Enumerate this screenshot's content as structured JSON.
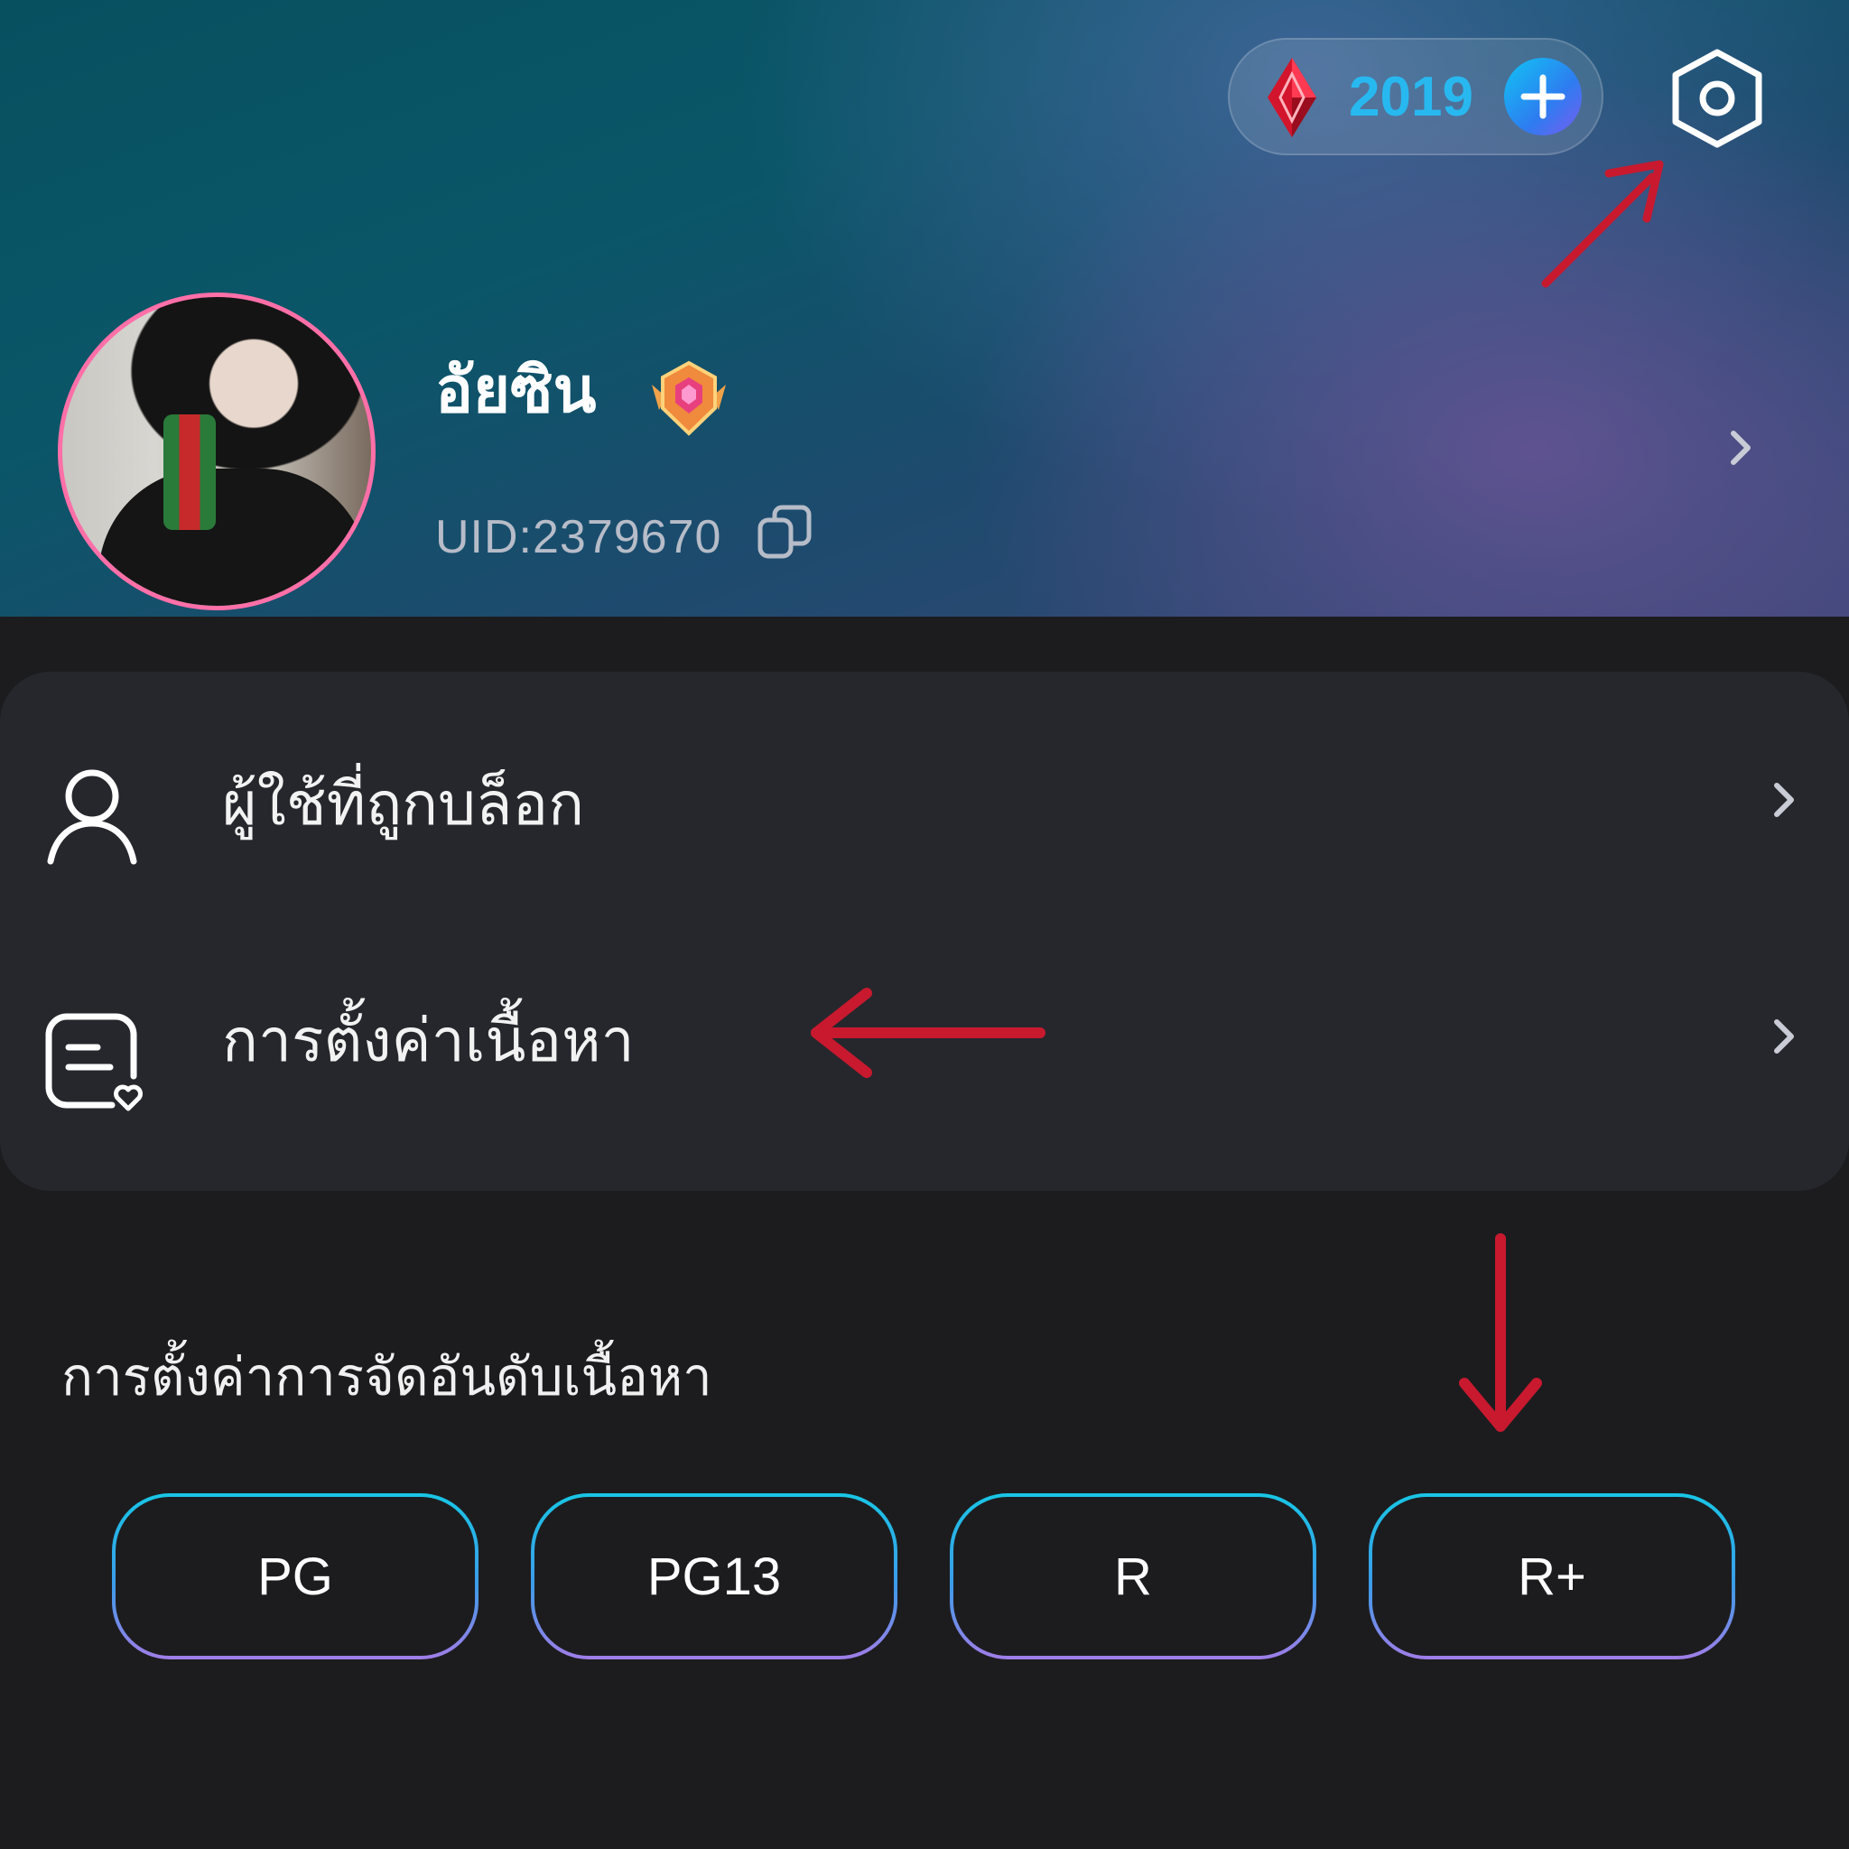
{
  "header": {
    "gems": {
      "count": "2019",
      "icon": "red-gem-icon",
      "add_icon": "plus-icon"
    },
    "settings_icon": "settings-hexagon-icon"
  },
  "profile": {
    "username": "อัยซิน",
    "badge_icon": "rank-badge-icon",
    "uid": "UID:2379670",
    "copy_icon": "copy-icon"
  },
  "menu": {
    "items": [
      {
        "label": "ผู้ใช้ที่ถูกบล็อก",
        "icon": "person-icon"
      },
      {
        "label": "การตั้งค่าเนื้อหา",
        "icon": "content-settings-icon"
      }
    ]
  },
  "content_rating": {
    "title": "การตั้งค่าการจัดอันดับเนื้อหา",
    "options": [
      "PG",
      "PG13",
      "R",
      "R+"
    ]
  },
  "colors": {
    "accent_cyan": "#18c6e6",
    "accent_purple": "#a07ee8",
    "annotation_red": "#c8192f",
    "card_bg": "#26272c",
    "page_bg": "#1c1c1f"
  }
}
